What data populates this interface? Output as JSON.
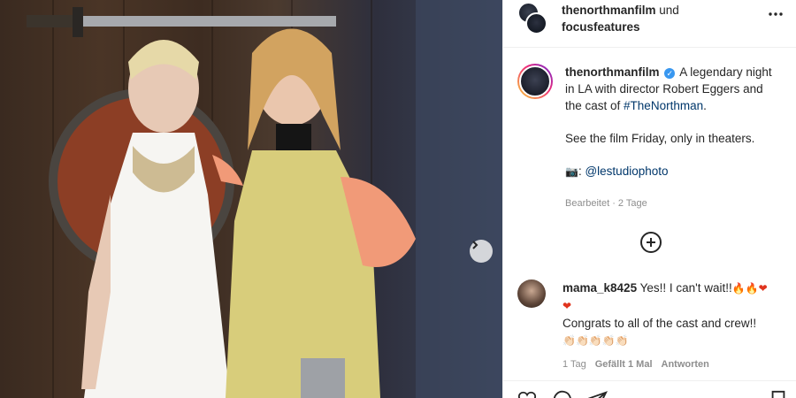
{
  "header": {
    "user1": "thenorthmanfilm",
    "and": "und",
    "user2": "focusfeatures"
  },
  "caption": {
    "user": "thenorthmanfilm",
    "line1": "A legendary night in LA with director Robert Eggers and the cast of ",
    "hashtag": "#TheNorthman",
    "line1_end": ".",
    "line2": "See the film Friday, only in theaters.",
    "camera_emoji": "📷",
    "credit_sep": ": ",
    "credit": "@lestudiophoto",
    "meta": "Bearbeitet · 2 Tage"
  },
  "comment": {
    "user": "mama_k8425",
    "text1": "Yes!! I can't wait!!",
    "emojis1": "🔥🔥❤",
    "emojis1b": "❤",
    "text2": "Congrats to all of the cast and crew!!",
    "emojis2": "👏🏻👏🏻👏🏻👏🏻👏🏻",
    "time": "1 Tag",
    "likes": "Gefällt 1 Mal",
    "reply": "Antworten"
  },
  "icons": {
    "more": "more-horizontal-icon",
    "next": "chevron-right-icon",
    "load_more": "plus-circle-icon",
    "like": "heart-icon",
    "comment": "comment-icon",
    "share": "share-icon",
    "save": "bookmark-icon"
  },
  "colors": {
    "link": "#00376b",
    "verified": "#3897f0",
    "muted": "#8e8e8e"
  }
}
